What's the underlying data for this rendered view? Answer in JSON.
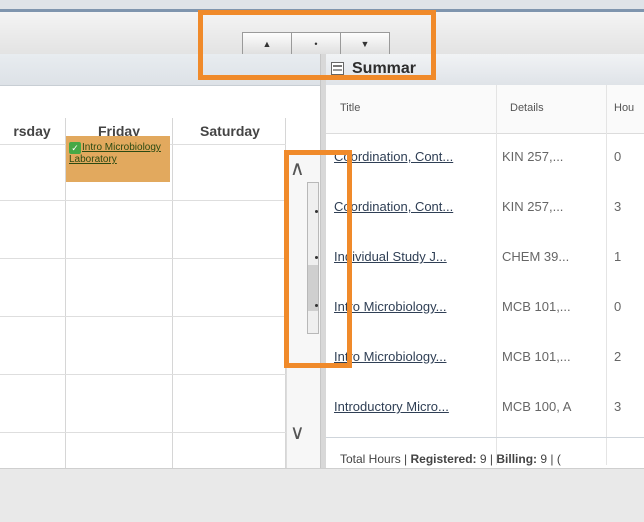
{
  "toolbar": {
    "buttons": [
      {
        "icon": "▲",
        "name": "up"
      },
      {
        "icon": "•",
        "name": "middle"
      },
      {
        "icon": "▼",
        "name": "down"
      }
    ]
  },
  "calendar": {
    "days": [
      "rsday",
      "Friday",
      "Saturday"
    ],
    "event": {
      "text": "Intro Microbiology Laboratory",
      "color": "#e2a95e"
    }
  },
  "summary": {
    "title": "Summar",
    "columns": {
      "title": "Title",
      "details": "Details",
      "hours": "Hou"
    },
    "rows": [
      {
        "title": "Coordination, Cont...",
        "details": "KIN 257,...",
        "hours": "0"
      },
      {
        "title": "Coordination, Cont...",
        "details": "KIN 257,...",
        "hours": "3"
      },
      {
        "title": "Individual Study J...",
        "details": "CHEM 39...",
        "hours": "1"
      },
      {
        "title": "Intro Microbiology...",
        "details": "MCB 101,...",
        "hours": "0"
      },
      {
        "title": "Intro Microbiology...",
        "details": "MCB 101,...",
        "hours": "2"
      },
      {
        "title": "Introductory Micro...",
        "details": "MCB 100, A",
        "hours": "3"
      }
    ],
    "total": {
      "label": "Total Hours |",
      "registered_label": "Registered:",
      "registered_value": "9",
      "billing_label": "Billing:",
      "billing_value": "9 | ("
    }
  },
  "scroll": {
    "up_icon": "∧",
    "down_icon": "∨"
  },
  "highlight_color": "#f08a2a"
}
